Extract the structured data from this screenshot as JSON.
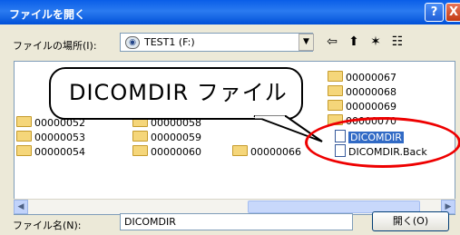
{
  "window": {
    "title": "ファイルを開く",
    "help_label": "?",
    "close_label": "X"
  },
  "look_in": {
    "label": "ファイルの場所(I):",
    "value": "TEST1 (F:)"
  },
  "toolbar": {
    "back_icon": "back-arrow-icon",
    "up_icon": "up-folder-icon",
    "new_folder_icon": "new-folder-icon",
    "views_icon": "views-menu-icon"
  },
  "files": [
    {
      "name": "00000067",
      "type": "folder"
    },
    {
      "name": "00000068",
      "type": "folder"
    },
    {
      "name": "00000069",
      "type": "folder"
    },
    {
      "name": "00000070",
      "type": "folder"
    },
    {
      "name": "00000052",
      "type": "folder"
    },
    {
      "name": "00000058",
      "type": "folder"
    },
    {
      "name": "00000053",
      "type": "folder"
    },
    {
      "name": "00000059",
      "type": "folder"
    },
    {
      "name": "00000054",
      "type": "folder"
    },
    {
      "name": "00000060",
      "type": "folder"
    },
    {
      "name": "00000066",
      "type": "folder"
    },
    {
      "name": "DICOMDIR",
      "type": "file",
      "selected": true
    },
    {
      "name": "DICOMDIR.Back",
      "type": "file"
    }
  ],
  "callout": {
    "text": "DICOMDIR ファイル"
  },
  "footer": {
    "filename_label": "ファイル名(N):",
    "filename_value": "DICOMDIR",
    "open_button": "開く(O)"
  }
}
